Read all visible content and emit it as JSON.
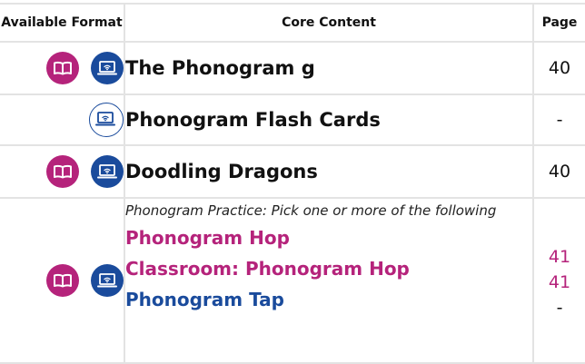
{
  "headers": {
    "format": "Available Format",
    "content": "Core Content",
    "page": "Page"
  },
  "rows": [
    {
      "title": "The Phonogram g",
      "page": "40",
      "formats": [
        "book-icon",
        "digital-icon"
      ]
    },
    {
      "title": "Phonogram Flash Cards",
      "page": "-",
      "formats": [
        "digital-outline-icon"
      ]
    },
    {
      "title": "Doodling Dragons",
      "page": "40",
      "formats": [
        "book-icon",
        "digital-icon"
      ]
    }
  ],
  "practice": {
    "intro": "Phonogram Practice: Pick one or more of the following",
    "items": [
      {
        "label": "Phonogram Hop",
        "page": "41"
      },
      {
        "label": "Classroom: Phonogram Hop",
        "page": "41"
      },
      {
        "label": "Phonogram Tap",
        "page": "-"
      }
    ],
    "formats": [
      "book-icon",
      "digital-icon"
    ]
  },
  "colors": {
    "magenta": "#b5237b",
    "blue": "#1a4b9c",
    "border": "#e3e3e3"
  }
}
